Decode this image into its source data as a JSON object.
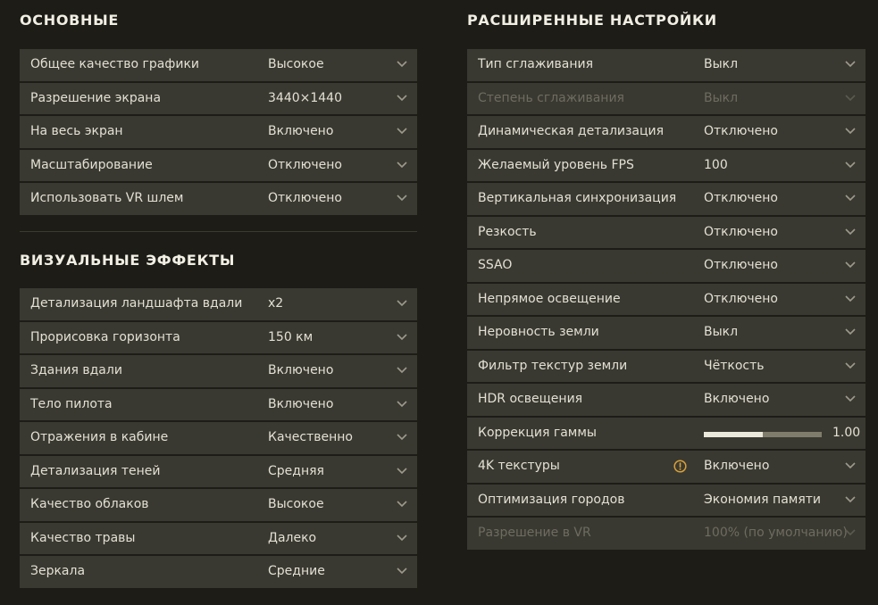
{
  "colors": {
    "background": "#1d1c17",
    "row": "#3a3931",
    "text": "#e3e0d4",
    "disabled_text": "#6e6c61",
    "warning": "#d8a13a"
  },
  "basic": {
    "title": "ОСНОВНЫЕ",
    "rows": [
      {
        "label": "Общее качество графики",
        "value": "Высокое"
      },
      {
        "label": "Разрешение экрана",
        "value": "3440×1440"
      },
      {
        "label": "На весь экран",
        "value": "Включено"
      },
      {
        "label": "Масштабирование",
        "value": "Отключено"
      },
      {
        "label": "Использовать VR шлем",
        "value": "Отключено"
      }
    ]
  },
  "visual": {
    "title": "ВИЗУАЛЬНЫЕ ЭФФЕКТЫ",
    "rows": [
      {
        "label": "Детализация ландшафта вдали",
        "value": "x2"
      },
      {
        "label": "Прорисовка горизонта",
        "value": "150 км"
      },
      {
        "label": "Здания вдали",
        "value": "Включено"
      },
      {
        "label": "Тело пилота",
        "value": "Включено"
      },
      {
        "label": "Отражения в кабине",
        "value": "Качественно"
      },
      {
        "label": "Детализация теней",
        "value": "Средняя"
      },
      {
        "label": "Качество облаков",
        "value": "Высокое"
      },
      {
        "label": "Качество травы",
        "value": "Далеко"
      },
      {
        "label": "Зеркала",
        "value": "Средние"
      }
    ]
  },
  "advanced": {
    "title": "РАСШИРЕННЫЕ НАСТРОЙКИ",
    "rows": [
      {
        "label": "Тип сглаживания",
        "value": "Выкл"
      },
      {
        "label": "Степень сглаживания",
        "value": "Выкл"
      },
      {
        "label": "Динамическая детализация",
        "value": "Отключено"
      },
      {
        "label": "Желаемый уровень FPS",
        "value": "100"
      },
      {
        "label": "Вертикальная синхронизация",
        "value": "Отключено"
      },
      {
        "label": "Резкость",
        "value": "Отключено"
      },
      {
        "label": "SSAO",
        "value": "Отключено"
      },
      {
        "label": "Непрямое освещение",
        "value": "Отключено"
      },
      {
        "label": "Неровность земли",
        "value": "Выкл"
      },
      {
        "label": "Фильтр текстур земли",
        "value": "Чёткость"
      },
      {
        "label": "HDR освещения",
        "value": "Включено"
      },
      {
        "label": "Коррекция гаммы",
        "value": "1.00",
        "slider_fraction": 0.5
      },
      {
        "label": "4K текстуры",
        "value": "Включено"
      },
      {
        "label": "Оптимизация городов",
        "value": "Экономия памяти"
      },
      {
        "label": "Разрешение в VR",
        "value": "100% (по умолчанию)"
      }
    ]
  }
}
